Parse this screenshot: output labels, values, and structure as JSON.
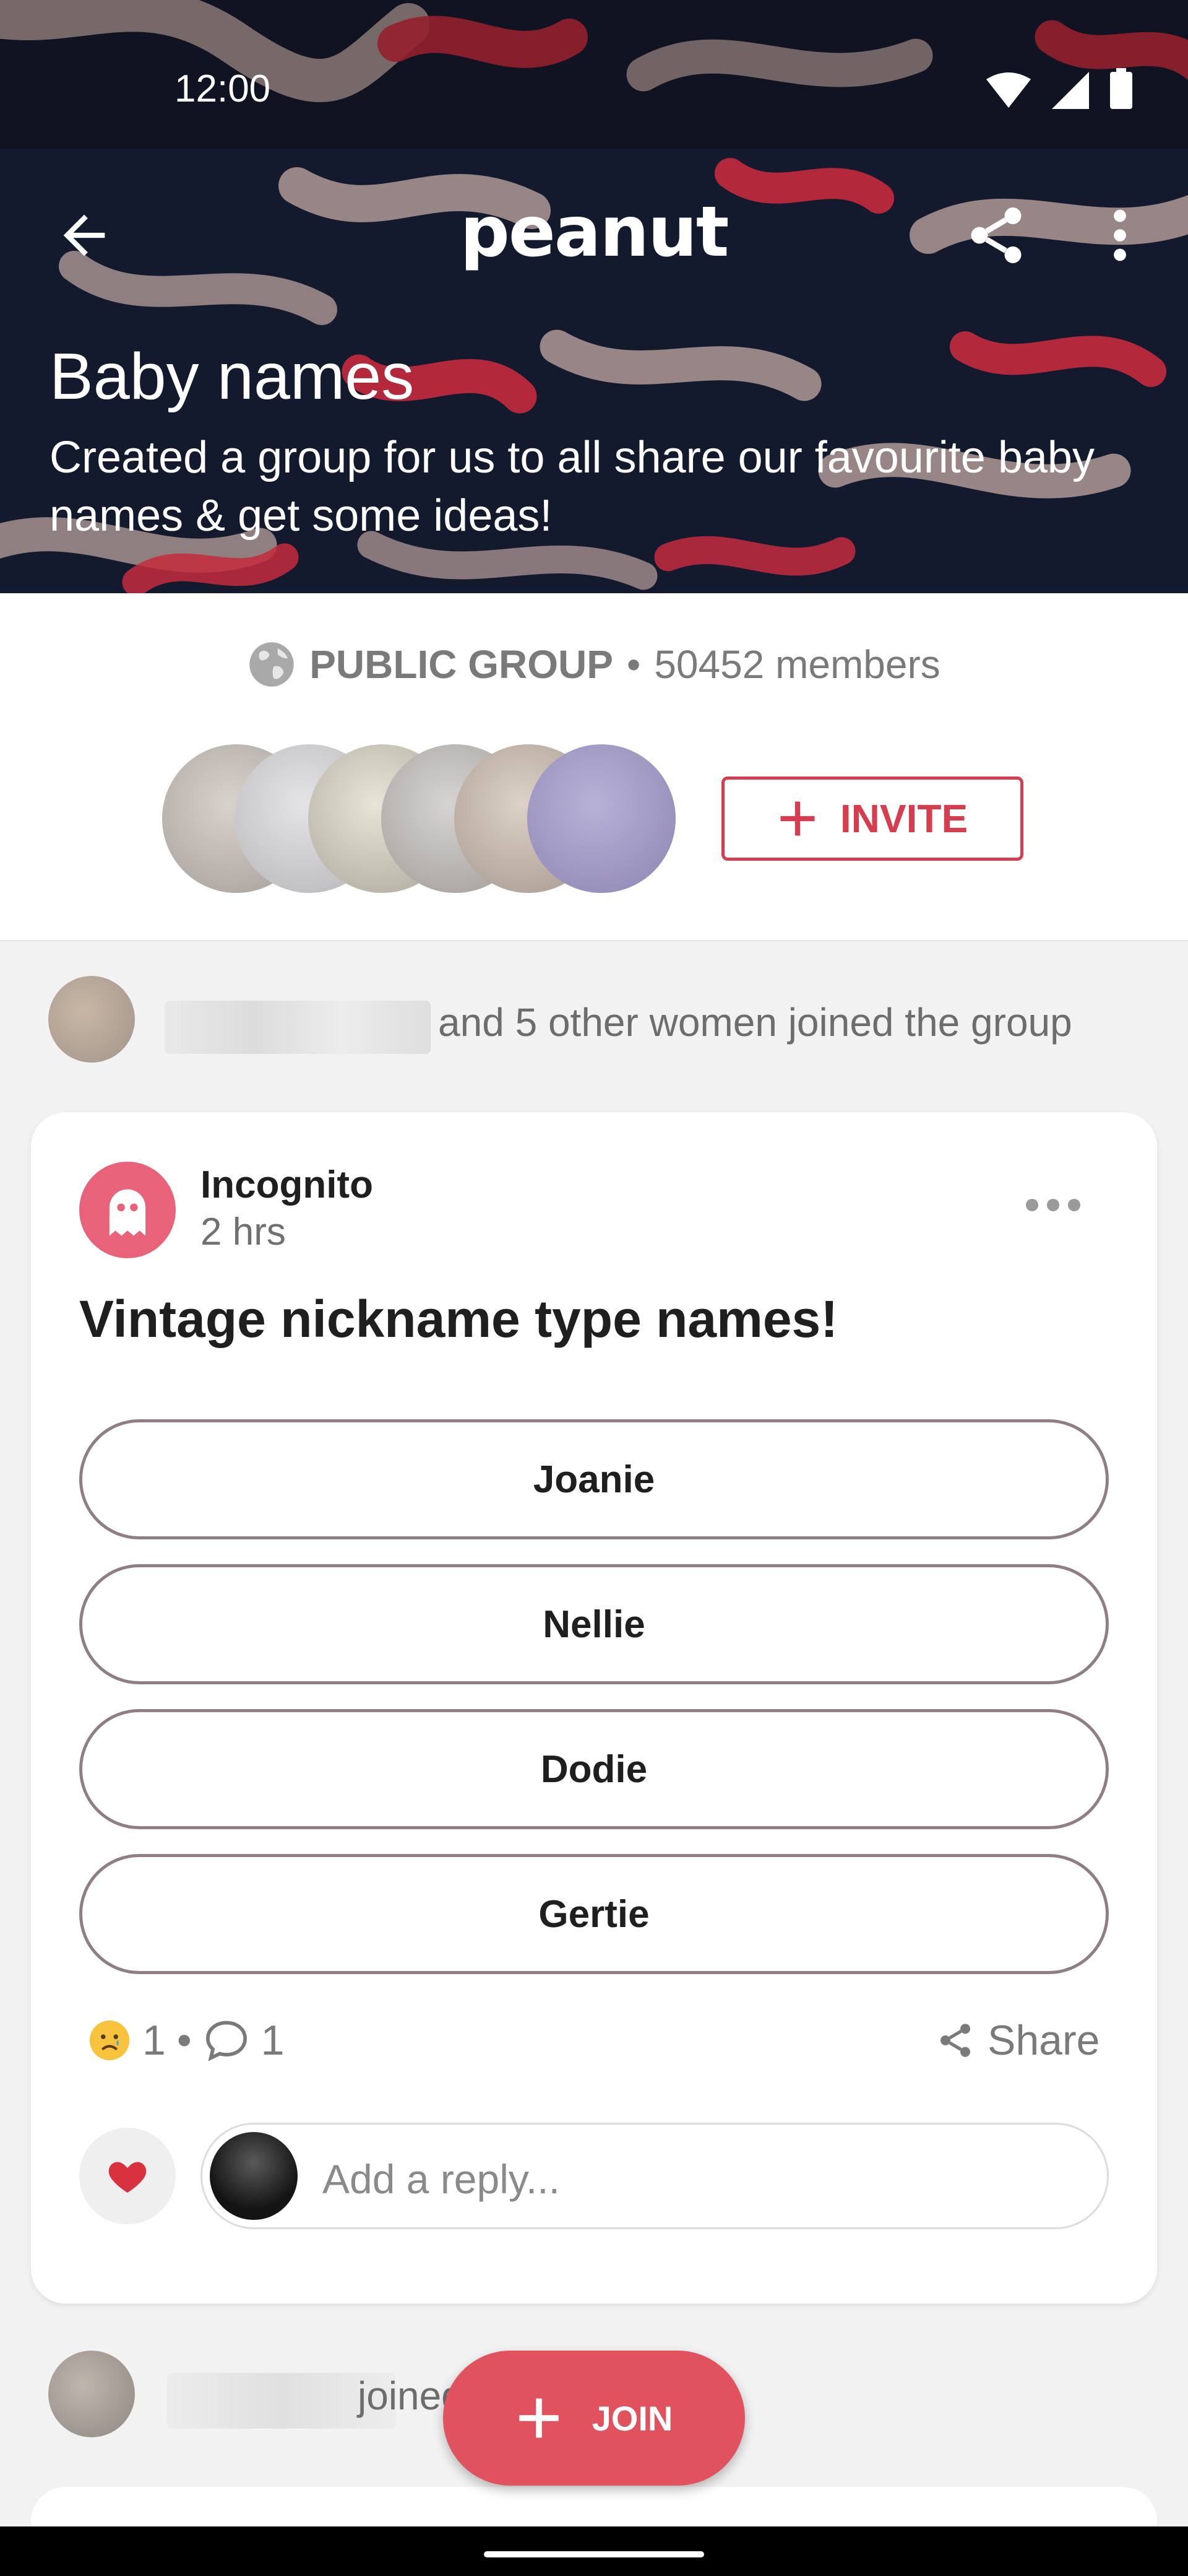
{
  "status_bar": {
    "time": "12:00"
  },
  "app_bar": {
    "logo": "peanut"
  },
  "group": {
    "title": "Baby names",
    "description": "Created a group for us to all share our favourite baby names & get some ideas!",
    "type": "PUBLIC GROUP",
    "separator": "•",
    "members": "50452 members",
    "invite_label": "INVITE"
  },
  "activity": [
    {
      "text": "and 5 other women joined the group"
    },
    {
      "text": "joined the group"
    }
  ],
  "post": {
    "author": "Incognito",
    "time": "2 hrs",
    "title": "Vintage nickname type names!",
    "poll_options": [
      "Joanie",
      "Nellie",
      "Dodie",
      "Gertie"
    ],
    "reaction_count": "1",
    "comment_count": "1",
    "dot": "•",
    "share_label": "Share",
    "reply_placeholder": "Add a reply..."
  },
  "join_label": "JOIN",
  "colors": {
    "accent": "#d63d4f",
    "join": "#e0525d",
    "header_bg": "#141a2e"
  },
  "icons": [
    "back-arrow-icon",
    "share-icon",
    "more-vert-icon",
    "globe-icon",
    "plus-icon",
    "ghost-icon",
    "more-horiz-icon",
    "sad-emoji-icon",
    "comment-icon",
    "heart-icon"
  ]
}
